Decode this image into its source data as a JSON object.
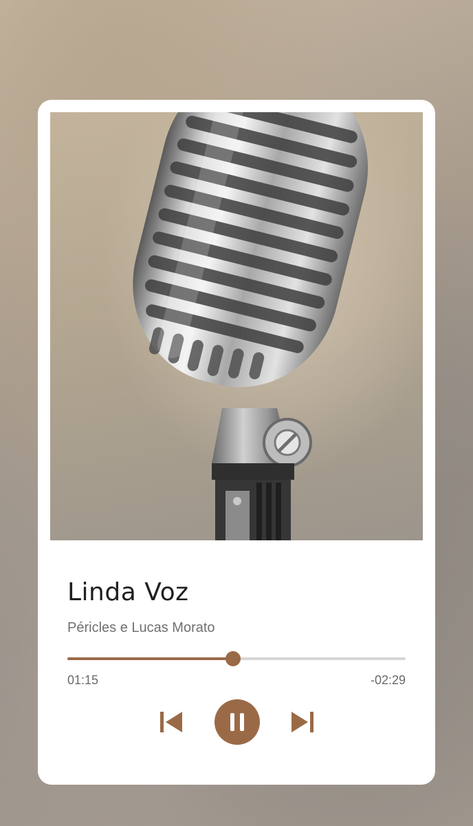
{
  "track": {
    "title": "Linda Voz",
    "artist": "Péricles e Lucas Morato",
    "artwork_icon": "microphone-artwork"
  },
  "playback": {
    "elapsed": "01:15",
    "remaining": "-02:29",
    "progress_fraction": 0.49,
    "state": "playing"
  },
  "controls": {
    "previous_icon": "skip-previous-icon",
    "pause_icon": "pause-icon",
    "next_icon": "skip-next-icon"
  },
  "colors": {
    "accent": "#9a6a47",
    "track": "#d6d6d6",
    "title": "#1f1f1f",
    "subtitle": "#707070"
  }
}
